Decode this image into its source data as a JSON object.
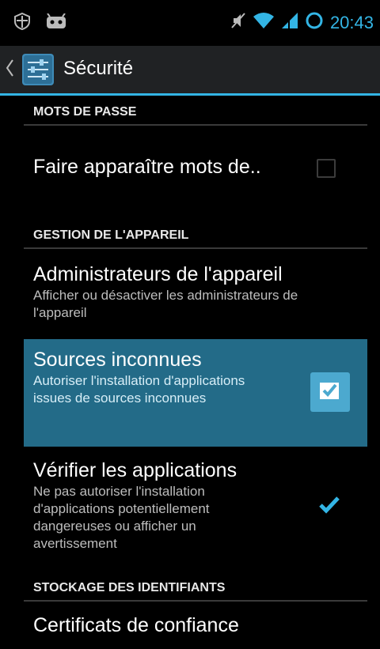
{
  "status_bar": {
    "time": "20:43",
    "icons": [
      "shield-icon",
      "android-icon",
      "mute-icon",
      "wifi-icon",
      "signal-icon",
      "sync-icon"
    ],
    "accent": "#33b5e5"
  },
  "action_bar": {
    "title": "Sécurité",
    "app_icon": "settings-sliders-icon"
  },
  "sections": {
    "passwords": {
      "header": "MOTS DE PASSE",
      "show_passwords": {
        "title": "Faire apparaître mots de..",
        "checked": false
      }
    },
    "device": {
      "header": "GESTION DE L'APPAREIL",
      "admins": {
        "title": "Administrateurs de l'appareil",
        "summary": "Afficher ou désactiver les administrateurs de l'appareil"
      },
      "unknown_sources": {
        "title": "Sources inconnues",
        "summary": "Autoriser l'installation d'applications issues de sources inconnues",
        "checked": true
      },
      "verify_apps": {
        "title": "Vérifier les applications",
        "summary": "Ne pas autoriser l'installation d'applications potentiellement dangereuses ou afficher un avertissement",
        "checked": true
      }
    },
    "credentials": {
      "header": "STOCKAGE DES IDENTIFIANTS",
      "trusted_certs": {
        "title": "Certificats de confiance"
      }
    }
  },
  "colors": {
    "highlight_bg": "#236b88",
    "checkbox_hl": "#4ca9cf"
  }
}
